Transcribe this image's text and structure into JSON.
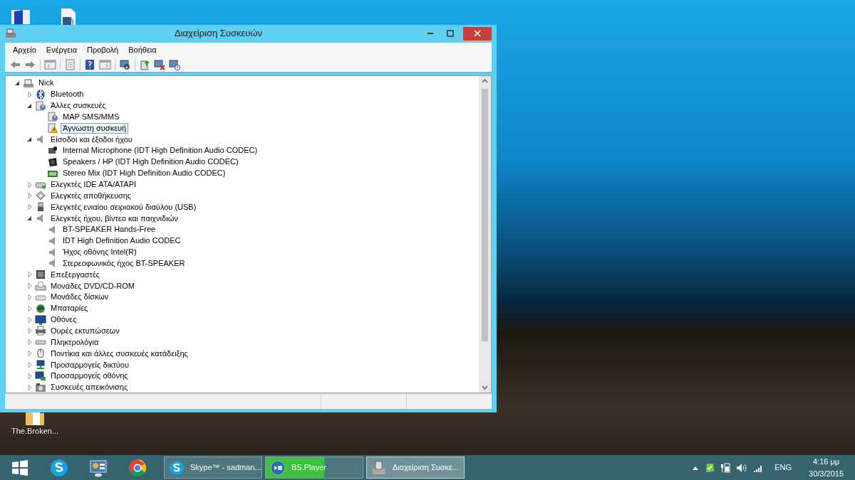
{
  "desktop_icons": [
    {
      "kind": "app"
    },
    {
      "kind": "video"
    },
    {
      "kind": "folder",
      "label": "The.Broken..."
    }
  ],
  "window": {
    "title": "Διαχείριση Συσκευών",
    "menu": [
      "Αρχείο",
      "Ενέργεια",
      "Προβολή",
      "Βοήθεια"
    ],
    "tree": {
      "label": "Nick",
      "kind": "computer",
      "expanded": true,
      "selected": false,
      "children": [
        {
          "label": "Bluetooth",
          "kind": "bluetooth",
          "expanded": false,
          "selected": false
        },
        {
          "label": "Άλλες συσκευές",
          "kind": "other",
          "expanded": true,
          "selected": false,
          "children": [
            {
              "label": "MAP SMS/MMS",
              "kind": "other",
              "selected": false
            },
            {
              "label": "Άγνωστη συσκευή",
              "kind": "unknown",
              "selected": true
            }
          ]
        },
        {
          "label": "Είσοδοι και έξοδοι ήχου",
          "kind": "sound",
          "expanded": true,
          "selected": false,
          "children": [
            {
              "label": "Internal Microphone (IDT High Definition Audio CODEC)",
              "kind": "microphone",
              "selected": false
            },
            {
              "label": "Speakers / HP (IDT High Definition Audio CODEC)",
              "kind": "speakers",
              "selected": false
            },
            {
              "label": "Stereo Mix (IDT High Definition Audio CODEC)",
              "kind": "card",
              "selected": false
            }
          ]
        },
        {
          "label": "Ελεγκτές IDE ATA/ATAPI",
          "kind": "ide",
          "expanded": false,
          "selected": false
        },
        {
          "label": "Ελεγκτές αποθήκευσης",
          "kind": "storage",
          "expanded": false,
          "selected": false
        },
        {
          "label": "Ελεγκτές ενιαίου σειριακού διαύλου (USB)",
          "kind": "usb",
          "expanded": false,
          "selected": false
        },
        {
          "label": "Ελεγκτές ήχου, βίντεο και παιχνιδιών",
          "kind": "sound",
          "expanded": true,
          "selected": false,
          "children": [
            {
              "label": "BT-SPEAKER Hands-Free",
              "kind": "sound",
              "selected": false
            },
            {
              "label": "IDT High Definition Audio CODEC",
              "kind": "sound",
              "selected": false
            },
            {
              "label": "Ήχος οθόνης Intel(R)",
              "kind": "sound",
              "selected": false
            },
            {
              "label": "Στερεοφωνικός ήχος BT-SPEAKER",
              "kind": "sound",
              "selected": false
            }
          ]
        },
        {
          "label": "Επεξεργαστές",
          "kind": "processor",
          "expanded": false,
          "selected": false
        },
        {
          "label": "Μονάδες DVD/CD-ROM",
          "kind": "dvd",
          "expanded": false,
          "selected": false
        },
        {
          "label": "Μονάδες δίσκων",
          "kind": "disk",
          "expanded": false,
          "selected": false
        },
        {
          "label": "Μπαταρίες",
          "kind": "battery",
          "expanded": false,
          "selected": false
        },
        {
          "label": "Οθόνες",
          "kind": "monitor",
          "expanded": false,
          "selected": false
        },
        {
          "label": "Ουρές εκτυπώσεων",
          "kind": "printer",
          "expanded": false,
          "selected": false
        },
        {
          "label": "Πληκτρολόγια",
          "kind": "keyboard",
          "expanded": false,
          "selected": false
        },
        {
          "label": "Ποντίκια και άλλες συσκευές κατάδειξης",
          "kind": "mouse",
          "expanded": false,
          "selected": false
        },
        {
          "label": "Προσαρμογείς δικτύου",
          "kind": "network",
          "expanded": false,
          "selected": false
        },
        {
          "label": "Προσαρμογείς οθόνης",
          "kind": "display",
          "expanded": false,
          "selected": false
        },
        {
          "label": "Συσκευές απεικόνισης",
          "kind": "imaging",
          "expanded": false,
          "selected": false
        }
      ]
    }
  },
  "taskbar": {
    "tasks": [
      {
        "label": "Skype™ - sadman...",
        "kind": "skype",
        "selected": false
      },
      {
        "label": "BS.Player",
        "kind": "player",
        "selected": false,
        "level": 0.6
      },
      {
        "label": "Διαχείριση Συσκε...",
        "kind": "devices",
        "selected": true
      }
    ],
    "language": "ENG",
    "time": "4:16 μμ",
    "date": "30/3/2015"
  }
}
